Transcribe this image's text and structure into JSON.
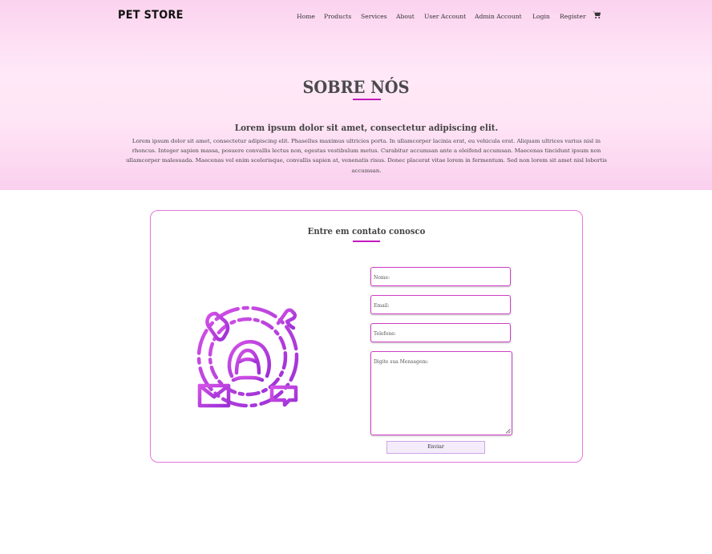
{
  "header": {
    "brand": "PET STORE",
    "nav": [
      "Home",
      "Products",
      "Services",
      "About",
      "User Account",
      "Admin Account",
      "Login",
      "Register"
    ],
    "cart_icon": "shopping-cart-icon"
  },
  "about": {
    "title": "SOBRE NÓS",
    "subtitle": "Lorem ipsum dolor sit amet, consectetur adipiscing elit.",
    "body": "Lorem ipsum dolor sit amet, consectetur adipiscing elit. Phasellus maximus ultricies porta. In ullamcorper lacinia erat, eu vehicula erat. Aliquam ultrices varius nisl in rhoncus. Integer sapien massa, posuere convallis lectus non, egestas vestibulum metus. Curabitur accumsan ante a eleifend accumsan. Maecenas tincidunt ipsum non ullamcorper malesuada. Maecenas vel enim scelerisque, convallis sapien at, venenatis risus. Donec placerat vitae lorem in fermentum. Sed non lorem sit amet nisl lobortis accumsan."
  },
  "contact": {
    "title": "Entre em contato conosco",
    "illustration_icon": "customer-support-icon",
    "fields": {
      "name_placeholder": "Nome:",
      "email_placeholder": "Email:",
      "phone_placeholder": "Telefone:",
      "message_placeholder": "Digite sua Mensagem:"
    },
    "submit_label": "Enviar"
  },
  "colors": {
    "accent": "#c31bbd",
    "card_border": "#e477db",
    "hero_pink": "#fbd3ef",
    "icon_gradient_start": "#d452e6",
    "icon_gradient_end": "#9b2fd6"
  }
}
